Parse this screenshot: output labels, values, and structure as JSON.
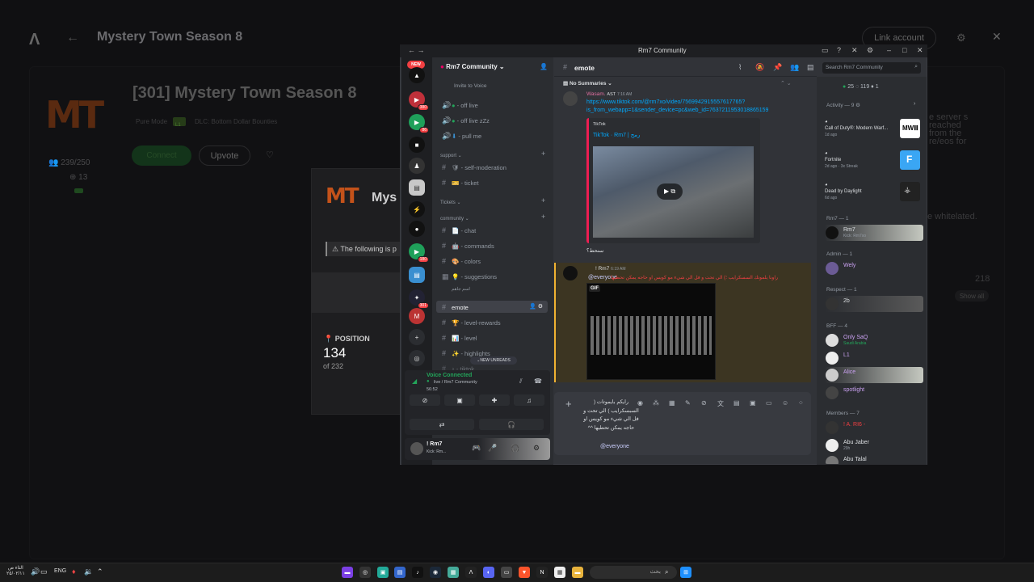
{
  "background_app": {
    "title": "Mystery Town Season 8",
    "link_button": "Link account",
    "server_title": "[301] Mystery Town Season 8",
    "mode": "Pure Mode",
    "tag": "L1",
    "dlc": "DLC: Bottom Dollar Bounties",
    "connect": "Connect",
    "upvote": "Upvote",
    "players": "239/250",
    "queue_count": "13",
    "right_text": "e server s reached from the re/eos for",
    "whitelisted": "e whitelated.",
    "count_218": "218",
    "show_all": "Show all",
    "modal": {
      "logo": "MT",
      "title": "Mys",
      "warning": "The following is p",
      "position_label": "POSITION",
      "position": "134",
      "of": "of 232"
    }
  },
  "discord": {
    "window_title": "Rm7 Community",
    "server_name": "Rm7 Community",
    "new_pill": "NEW",
    "guild_badges": [
      "380",
      "86",
      "180",
      "301"
    ],
    "channels": {
      "invite": "Invite to Voice",
      "c1": "off live",
      "c2": "off live zZz",
      "c3": "pull me",
      "cat_support": "support",
      "c4": "self-moderation",
      "c5": "ticket",
      "cat_tickets": "Tickets",
      "cat_community": "community",
      "c6": "chat",
      "c7": "commands",
      "c8": "colors",
      "c9": "suggestions",
      "thread": "اسم جاهم",
      "c10": "emote",
      "c11": "level-rewards",
      "c12": "level",
      "c13": "highlights",
      "c14": "tiktok"
    },
    "new_unreads": "NEW UNREADS",
    "voice": {
      "status": "Voice Connected",
      "channel": "live / Rm7 Community",
      "time": "56:52"
    },
    "user": {
      "name": "! Rm7",
      "status": "Kick: Rm..."
    },
    "chat": {
      "channel": "emote",
      "search_placeholder": "Search Rm7 Community",
      "no_summaries": "No Summaries",
      "msg1_author": "Wasam.",
      "msg1_tag": "AST",
      "msg1_time": "7:16 AM",
      "msg1_link1": "https://www.tiktok.com/@rm7xo/video/7569942915557617765?",
      "msg1_link2": "is_from_webapp=1&sender_device=pc&web_id=7637211953018865159",
      "embed_source": "TikTok",
      "embed_title": "TikTok · Rm7 | رمح",
      "msg1_footer": "سنحط؟",
      "msg2_author": "! Rm7",
      "msg2_time": "6:19 AM",
      "msg2_mention": "@everyone",
      "msg2_text": "راونا يلموتك السسكرايب ؛) الي تحت و فل الي شيء مو كويس او حاجه يمكن تحطيها",
      "gif_label": "GIF",
      "composer_text": "رايكم بايموتات ( السبسكرايب ) الي تحت و فل الي شيء مو كويس او حاجه يمكن تحطيها ^^",
      "composer_mention": "@everyone"
    },
    "members": {
      "online_count": "25",
      "count2": "119",
      "count3": "1",
      "activity_header": "Activity — 9",
      "activities": [
        {
          "game": "Call of Duty®: Modern Warf...",
          "sub": "1d ago"
        },
        {
          "game": "Fortnite",
          "sub": "2d ago · 3x Streak"
        },
        {
          "game": "Dead by Daylight",
          "sub": "6d ago"
        }
      ],
      "groups": [
        {
          "header": "Rm7 — 1",
          "members": [
            {
              "name": "Rm7",
              "sub": "Kick: Rm7xo"
            }
          ]
        },
        {
          "header": "Admin — 1",
          "members": [
            {
              "name": "Wely",
              "sub": ""
            }
          ]
        },
        {
          "header": "Respect — 1",
          "members": [
            {
              "name": "2b",
              "sub": ""
            }
          ]
        },
        {
          "header": "BFF — 4",
          "members": [
            {
              "name": "Only SaQ",
              "sub": "Saudi Arabia"
            },
            {
              "name": "L1",
              "sub": ""
            },
            {
              "name": "Alice",
              "sub": ""
            },
            {
              "name": "spotlight",
              "sub": ""
            }
          ]
        },
        {
          "header": "Members — 7",
          "members": [
            {
              "name": "! A. RI6 -",
              "sub": ""
            },
            {
              "name": "Abu Jaber",
              "sub": "29h"
            },
            {
              "name": "Abu Talal",
              "sub": ""
            }
          ]
        }
      ]
    }
  },
  "taskbar": {
    "time": "الثاء ص",
    "date": "٢٥/٠٢/١١",
    "lang": "ENG",
    "search_placeholder": "بحث"
  },
  "colors": {
    "discord_green": "#23a55a",
    "discord_red": "#f23f42",
    "link_blue": "#00a8fc",
    "mention_bg": "#3c3522"
  }
}
